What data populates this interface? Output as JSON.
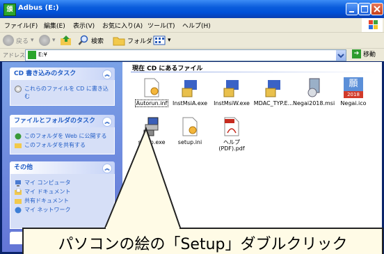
{
  "window": {
    "title": "Adbus (E:)",
    "app_icon": "頒"
  },
  "menu": [
    "ファイル(F)",
    "編集(E)",
    "表示(V)",
    "お気に入り(A)",
    "ツール(T)",
    "ヘルプ(H)"
  ],
  "toolbar": {
    "back": "戻る",
    "search": "検索",
    "folders": "フォルダ"
  },
  "address": {
    "label": "アドレス(D)",
    "value": "E:¥",
    "go": "移動"
  },
  "tasks": {
    "cd_panel": {
      "title": "CD 書き込みのタスク",
      "items": [
        "これらのファイルを CD に書き込む"
      ]
    },
    "file_panel": {
      "title": "ファイルとフォルダのタスク",
      "items": [
        "このフォルダを Web に公開する",
        "このフォルダを共有する"
      ]
    },
    "other_panel": {
      "title": "その他",
      "items": [
        "マイ コンピュータ",
        "マイ ドキュメント",
        "共有ドキュメント",
        "マイ ネットワーク"
      ]
    }
  },
  "files": {
    "heading": "現在 CD にあるファイル",
    "items": [
      "Autorun.inf",
      "InstMsiA.exe",
      "InstMsiW.exe",
      "MDAC_TYP.E...",
      "Negai2018.msi",
      "Negai.ico",
      "setup.exe",
      "setup.ini",
      "ヘルプ\n(PDF).pdf"
    ],
    "negai_badge": {
      "glyph": "願",
      "year": "2018"
    }
  },
  "callout": {
    "text": "パソコンの絵の「Setup」ダブルクリック"
  },
  "colors": {
    "titlebar": "#0b5ddc",
    "taskpane": "#6f8ee0",
    "panel_text": "#215dc6",
    "callout_bg": "#fffbe6"
  }
}
